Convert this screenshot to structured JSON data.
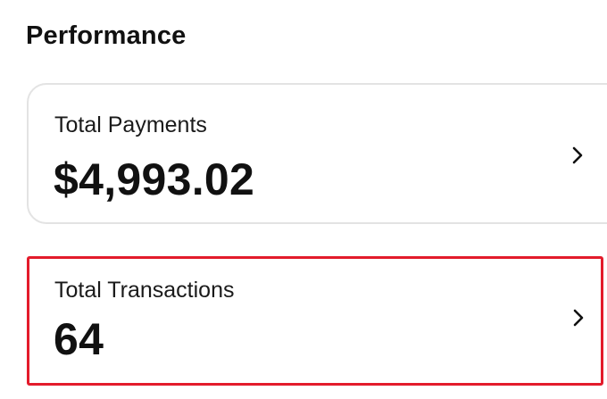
{
  "section": {
    "title": "Performance"
  },
  "cards": {
    "payments": {
      "label": "Total Payments",
      "value": "$4,993.02",
      "icon": "chevron-right-icon"
    },
    "transactions": {
      "label": "Total Transactions",
      "value": "64",
      "icon": "chevron-right-icon",
      "highlight_color": "#e31b2b"
    }
  }
}
